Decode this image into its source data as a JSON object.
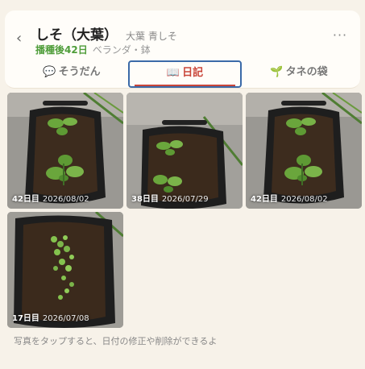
{
  "header": {
    "title": "しそ（大葉）",
    "subtitle": "大葉 青しそ",
    "days_since_sowing": "播種後42日",
    "location": "ベランダ・鉢",
    "back_icon": "chevron-left-icon",
    "more_icon": "more-horizontal-icon"
  },
  "tabs": [
    {
      "label": "そうだん",
      "icon": "💬",
      "active": false
    },
    {
      "label": "日記",
      "icon": "📖",
      "active": true
    },
    {
      "label": "タネの袋",
      "icon": "🌱",
      "active": false
    }
  ],
  "photos": [
    {
      "day": "42日目",
      "date": "2026/08/02"
    },
    {
      "day": "38日目",
      "date": "2026/07/29"
    },
    {
      "day": "42日目",
      "date": "2026/08/02"
    },
    {
      "day": "17日目",
      "date": "2026/07/08"
    }
  ],
  "hint": "写真をタップすると、日付の修正や削除ができるよ",
  "colors": {
    "background": "#f7f2e9",
    "accent_green": "#4f9d3a",
    "active_tab": "#c9463a",
    "focus_border": "#3b6aa8"
  }
}
